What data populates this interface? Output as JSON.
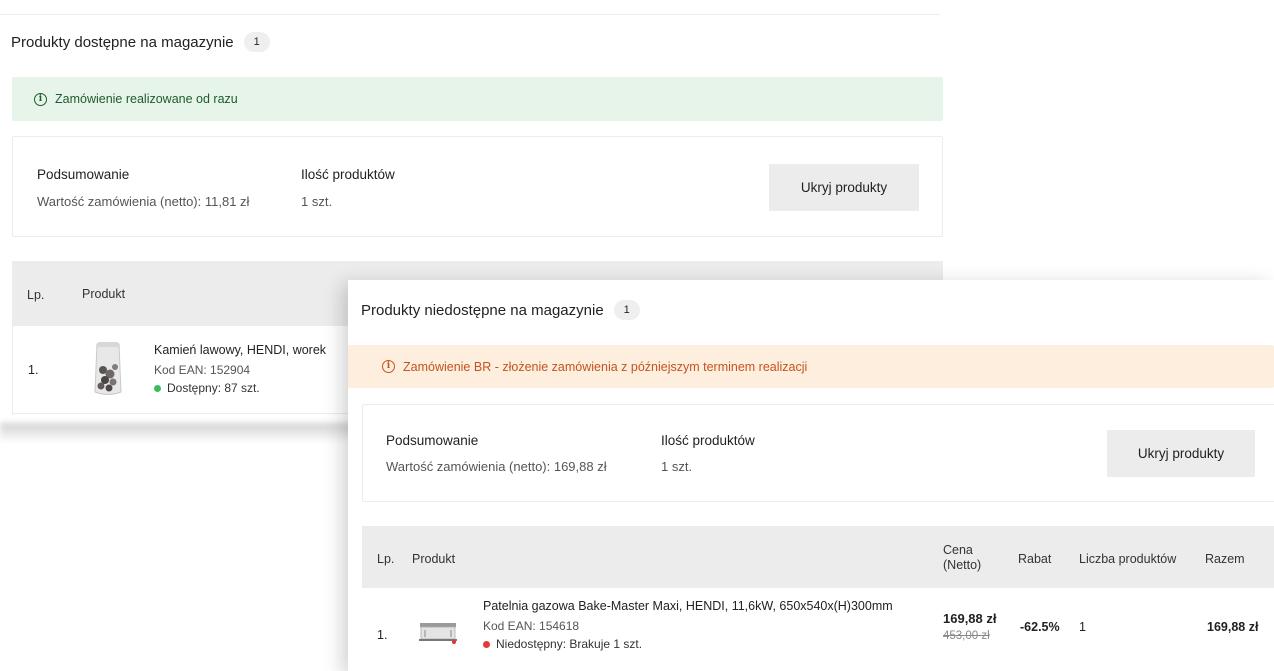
{
  "available": {
    "title": "Produkty dostępne na magazynie",
    "count": "1",
    "alert": "Zamówienie realizowane od razu",
    "summary": {
      "label_value": "Podsumowanie",
      "order_value": "Wartość zamówienia (netto): 11,81 zł",
      "label_qty": "Ilość produktów",
      "qty": "1 szt.",
      "hide_button": "Ukryj produkty"
    },
    "table": {
      "headers": {
        "lp": "Lp.",
        "product": "Produkt"
      },
      "rows": [
        {
          "lp": "1.",
          "name": "Kamień lawowy, HENDI, worek",
          "ean": "Kod EAN: 152904",
          "status_label": "Dostępny:",
          "status_value": " 87 szt."
        }
      ]
    }
  },
  "unavailable": {
    "title": "Produkty niedostępne na magazynie",
    "count": "1",
    "alert": "Zamówienie BR - złożenie zamówienia z późniejszym terminem realizacji",
    "summary": {
      "label_value": "Podsumowanie",
      "order_value": "Wartość zamówienia (netto): 169,88 zł",
      "label_qty": "Ilość produktów",
      "qty": "1 szt.",
      "hide_button": "Ukryj produkty"
    },
    "table": {
      "headers": {
        "lp": "Lp.",
        "product": "Produkt",
        "price_line1": "Cena",
        "price_line2": "(Netto)",
        "discount": "Rabat",
        "qty": "Liczba produktów",
        "total": "Razem"
      },
      "rows": [
        {
          "lp": "1.",
          "name": "Patelnia gazowa Bake-Master Maxi, HENDI, 11,6kW, 650x540x(H)300mm",
          "ean": "Kod EAN: 154618",
          "status_label": "Niedostępny:",
          "status_value": " Brakuje 1 szt.",
          "price": "169,88 zł",
          "price_old": "453,00 zł",
          "discount": "-62.5%",
          "qty": "1",
          "total": "169,88 zł"
        }
      ]
    }
  },
  "colors": {
    "available_dot": "#3dbb5c",
    "unavailable_dot": "#e5393b",
    "success_bg": "#e6f4ea",
    "warning_bg": "#fdeede"
  },
  "icons": {
    "alert_icon": "info-circle-icon",
    "product_a": "lava-stone-bag-image",
    "product_b": "gas-griddle-image"
  }
}
